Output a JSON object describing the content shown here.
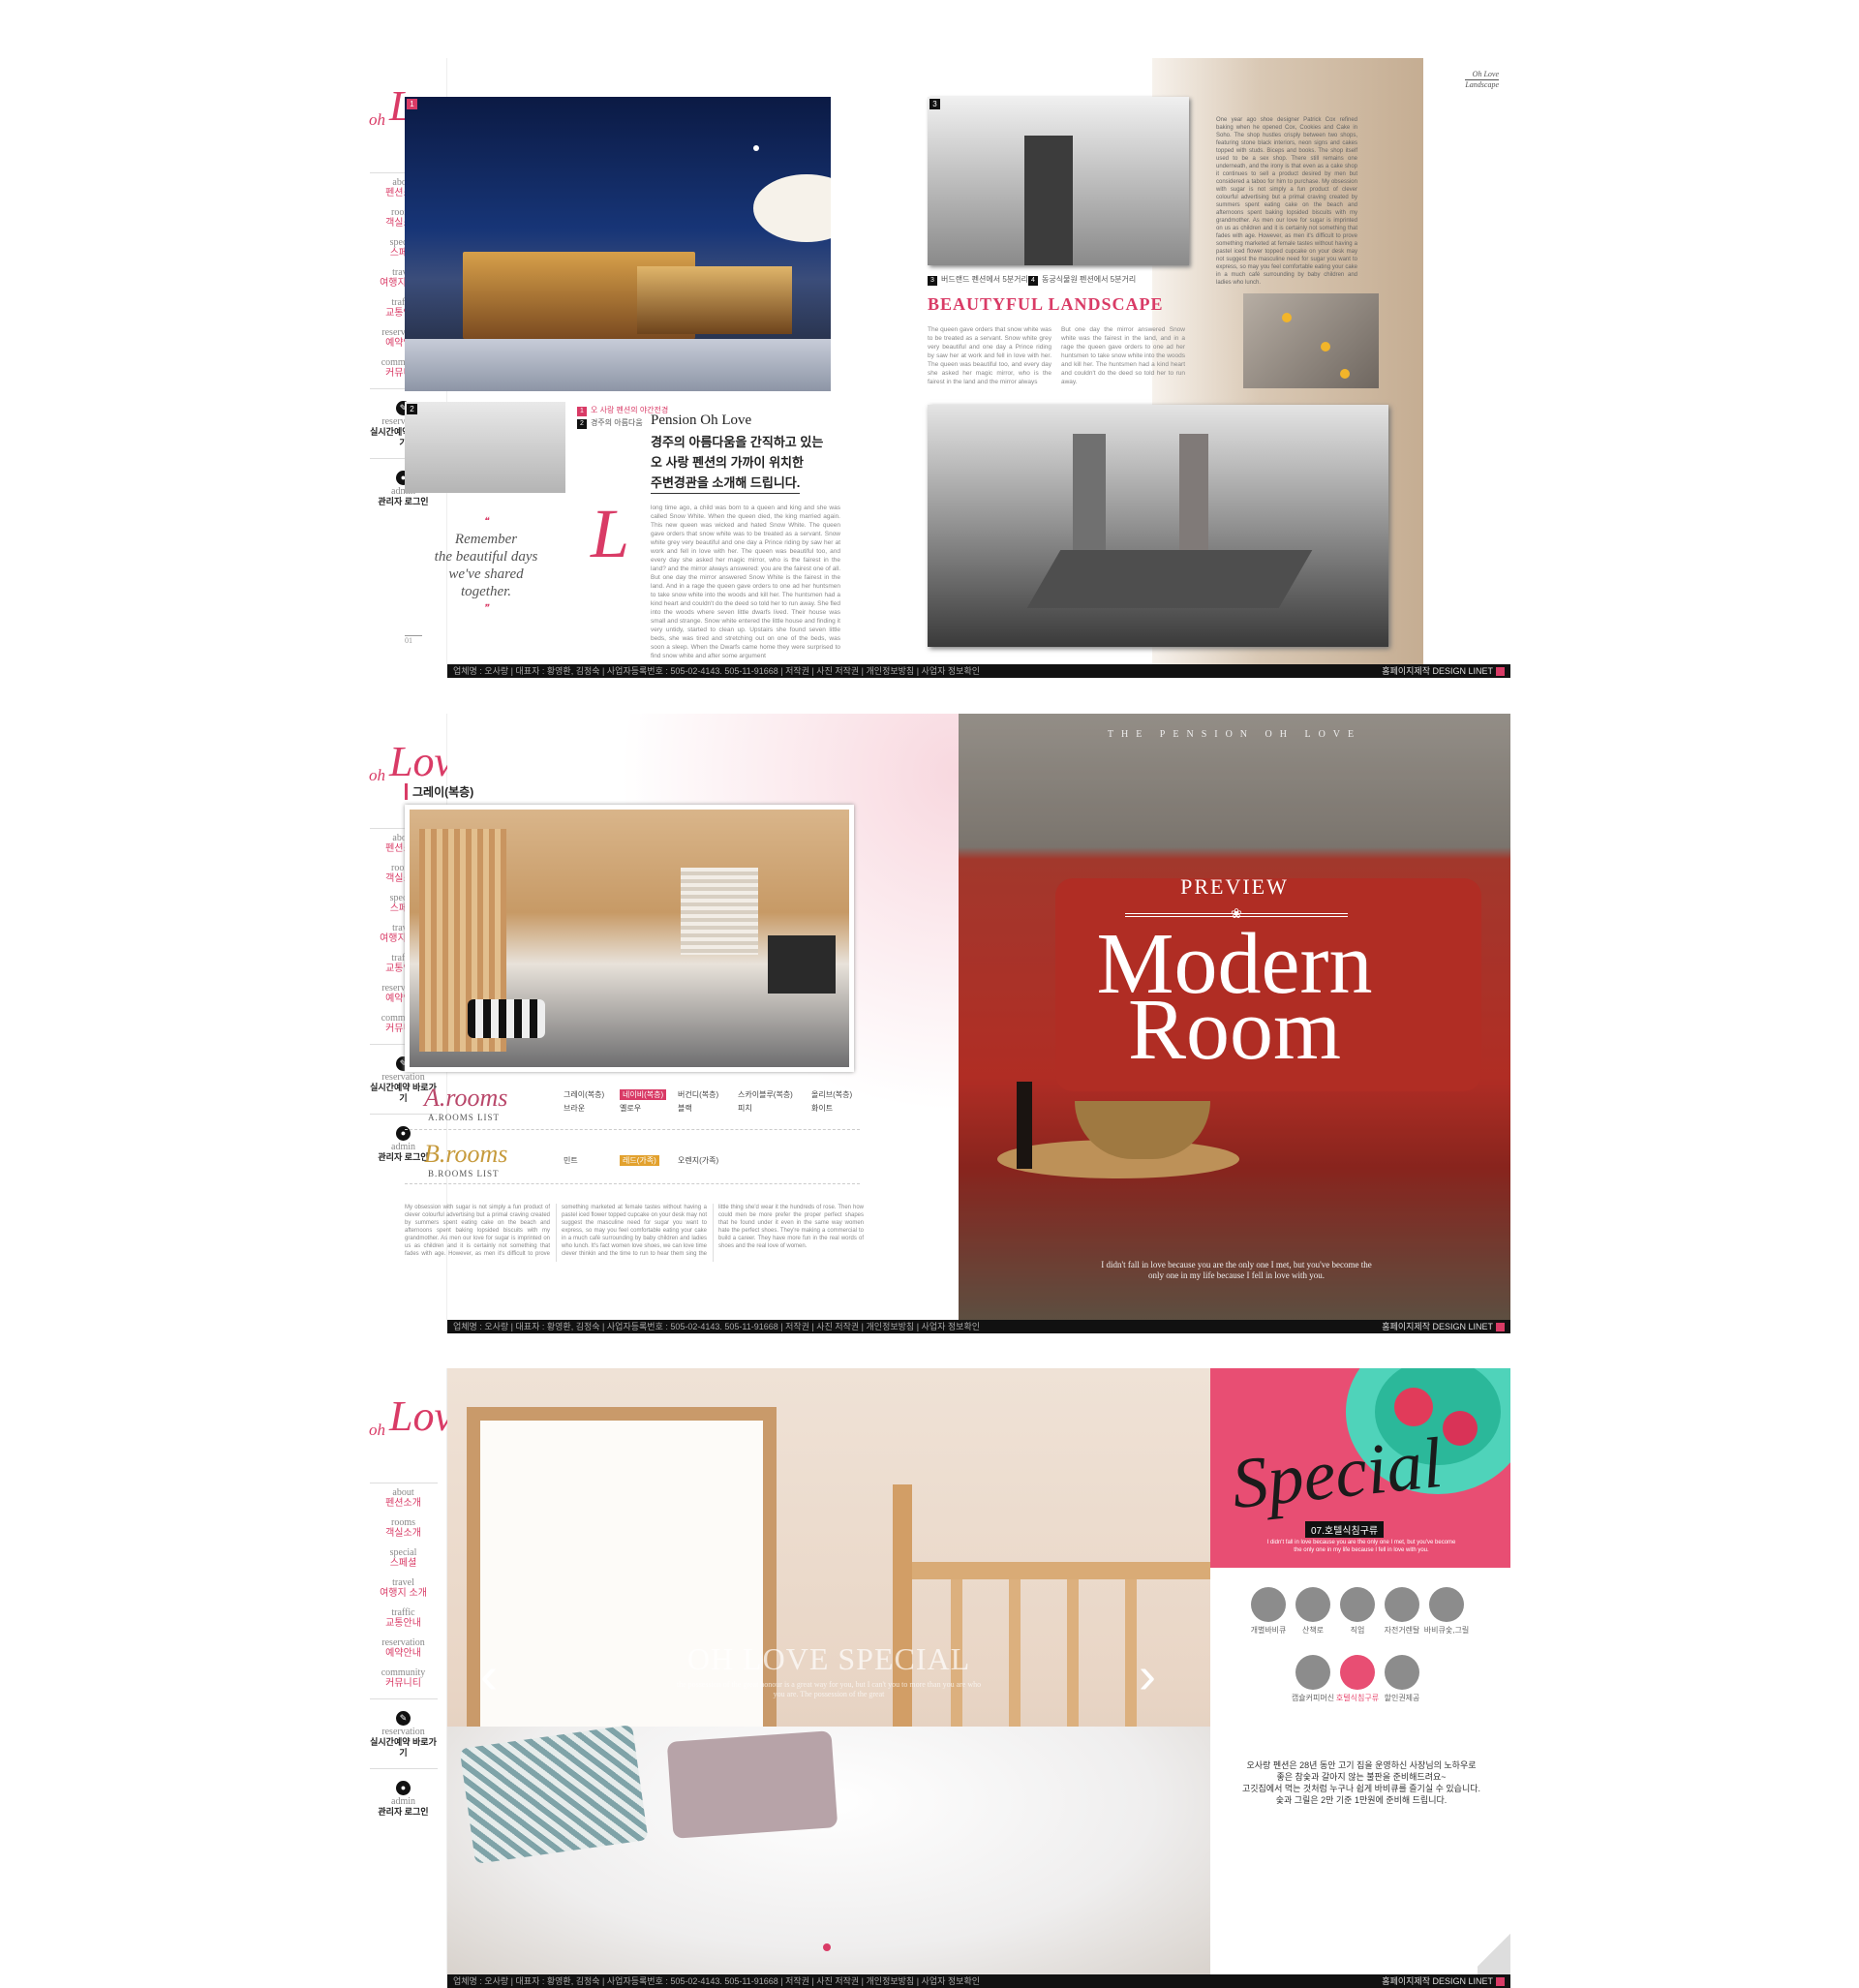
{
  "sidebar": {
    "logo_oh": "oh",
    "logo_love": "Love",
    "nav": [
      {
        "en": "about",
        "ko": "펜션소개"
      },
      {
        "en": "rooms",
        "ko": "객실소개"
      },
      {
        "en": "special",
        "ko": "스페셜"
      },
      {
        "en": "travel",
        "ko": "여행지 소개"
      },
      {
        "en": "traffic",
        "ko": "교통안내"
      },
      {
        "en": "reservation",
        "ko": "예약안내"
      },
      {
        "en": "community",
        "ko": "커뮤니티"
      }
    ],
    "reservation_en": "reservation",
    "reservation_ko": "실시간예약 바로가기",
    "admin_en": "admin",
    "admin_ko": "관리자 로그인"
  },
  "footer": {
    "left": "업체명 : 오사랑  |  대표자 : 황영환, 김정숙  |  사업자등록번호 : 505-02-4143.  505-11-91668  |  저작권  |  사진 저작권  |  개인정보방침  |  사업자 정보확인",
    "right": "홈페이지제작 DESIGN LINET"
  },
  "page1": {
    "header_right_1": "Oh Love",
    "header_right_2": "Landscape",
    "photo_nums": [
      "1",
      "2",
      "3",
      "4"
    ],
    "caption_1": "오 사랑 펜션의 야간전경",
    "caption_2": "경주의 아름다움",
    "caption_3": "버드랜드 펜션에서 5분거리",
    "caption_4": "동궁식물원 펜션에서 5분거리",
    "heading": "BEAUTYFUL LANDSCAPE",
    "pension_title": "Pension Oh Love",
    "intro_ko_1": "경주의 아름다움을 간직하고 있는",
    "intro_ko_2": "오 사랑 펜션의 가까이 위치한",
    "intro_ko_3": "주변경관을 소개해 드립니다.",
    "quote_1": "Remember",
    "quote_2": "the beautiful days",
    "quote_3": "we've shared",
    "quote_4": "together.",
    "quote_mark_top": "❝",
    "quote_mark_bottom": "❞",
    "big_letter": "L",
    "page_number": "01",
    "body_text_1": "long time ago, a child was born to a queen and king and she was called Snow White. When the queen died, the king married again. This new queen was wicked and hated Snow White. The queen gave orders that snow white was to be treated as a servant. Snow white grey very beautiful and one day a Prince riding by saw her at work and fell in love with her. The queen was beautiful too, and every day she asked her magic mirror, who is the fairest in the land? and the mirror always answered: you are the fairest one of all. But one day the mirror answered Snow White is the fairest in the land. And in a rage the queen gave orders to one ad her huntsmen to take snow white into the woods and kill her. The huntsmen had a kind heart and couldn't do the deed so told her to run away. She fled into the woods where seven little dwarfs lived. Their house was small and strange. Snow white entered the little house and finding it very untidy, started to clean up. Upstairs she found seven little beds, she was tired and stretching out on one of the beds, was soon a sleep. When the Dwarfs came home they were surprised to find snow white and after some argument",
    "body_text_2": "The queen gave orders that snow white was to be treated as a servant. Snow white grey very beautiful and one day a Prince riding by saw her at work and fell in love with her. The queen was beautiful too, and every day she asked her magic mirror, who is the fairest in the land and the mirror always",
    "body_text_3": "But one day the mirror answered Snow white was the fairest in the land, and in a rage the queen gave orders to one ad her huntsmen to take snow white into the woods and kill her. The huntsmen had a kind heart and couldn't do the deed so told her to run away.",
    "right_text": "One year ago shoe designer Patrick Cox refined baking when he opened Cox, Cookies and Cake in Soho. The shop hustles crisply between two shops, featuring stone black interiors, neon signs and cakes topped with studs. Biceps and books. The shop itself used to be a sex shop. There still remains one underneath, and the irony is that even as a cake shop it continues to sell a product desired by men but considered a taboo for him to purchase. My obsession with sugar is not simply a fun product of clever colourful advertising but a primal craving created by summers spent eating cake on the beach and afternoons spent baking lopsided biscuits with my grandmother. As men our love for sugar is imprinted on us as children and it is certainly not something that fades with age. However, as men it's difficult to prove something marketed at female tastes without having a pastel iced flower topped cupcake on your desk may not suggest the masculine need for sugar you want to express, so may you feel comfortable eating your cake in a much café surrounding by baby children and ladies who lunch."
  },
  "page2": {
    "section_title": "그레이(복층)",
    "a_rooms_script": "A.rooms",
    "a_rooms_label": "A.ROOMS LIST",
    "b_rooms_script": "B.rooms",
    "b_rooms_label": "B.ROOMS LIST",
    "a_rooms": [
      [
        "그레이(복층)",
        "네이비(복층)",
        "버건디(복층)",
        "스카이블루(복층)",
        "올리브(복층)"
      ],
      [
        "브라운",
        "옐로우",
        "블랙",
        "피치",
        "화이트"
      ]
    ],
    "b_rooms": [
      "민트",
      "레드(가족)",
      "오렌지(가족)"
    ],
    "body_text": "My obsession with sugar is not simply a fun product of clever colourful advertising but a primal craving created by summers spent eating cake on the beach and afternoons spent baking lopsided biscuits with my grandmother. As men our love for sugar is imprinted on us as children and it is certainly not something that fades with age. However, as men it's difficult to prove something marketed at female tastes without having a pastel iced flower topped cupcake on your desk may not suggest the masculine need for sugar you want to express, so may you feel comfortable eating your cake in a much café surrounding by baby children and ladies who lunch. It's fact women love shoes, we can love time clever thinkin and the time to run to hear them sing the little thing she'd wear it the hundreds of rose. Then how could men be more prefer the proper perfect shapes that he found under it even in the same way women hate the perfect shoes. They're making a commercial to build a career. They have more fun in the real words of shoes and the real love of women.",
    "tagline": "THE PENSION OH LOVE",
    "preview": "PREVIEW",
    "modern": "Modern",
    "room": "Room",
    "quote": "I didn't fall in love because you are the only one I met, but you've become the only one in my life because I fell in love with you."
  },
  "page3": {
    "slider_title": "OH LOVE SPECIAL",
    "slider_sub": "the possession of the great honour is a great way for you, but I can't you to more than you are who you are. The possession of the great",
    "special_script": "Special",
    "special_tag": "07.호텔식침구류",
    "special_sub": "I didn't fall in love because you are the only one I met, but you've become the only one in my life because I fell in love with you.",
    "icons": [
      "개별바비큐",
      "산책로",
      "직업",
      "자전거렌탈",
      "바비큐숯,그릴",
      "캡슐커피머신",
      "호텔식침구류",
      "할인권제공"
    ],
    "desc_1": "오사랑 펜션은 28년 동안 고기 집을 운영하신 사장님의 노하우로",
    "desc_2": "좋은 참숯과 갈아지 않는 불판을 준비해드려요~",
    "desc_3": "고깃집에서 먹는 것처럼 누구나 쉽게 바비큐를 즐기실 수 있습니다.",
    "desc_4": "숯과 그릴은 2만 기준 1만원에 준비해 드립니다."
  },
  "colors": {
    "accent": "#d93b66",
    "special_bg": "#e84e73",
    "sofa_red": "#c9342a",
    "sand": "#c9b49c"
  }
}
